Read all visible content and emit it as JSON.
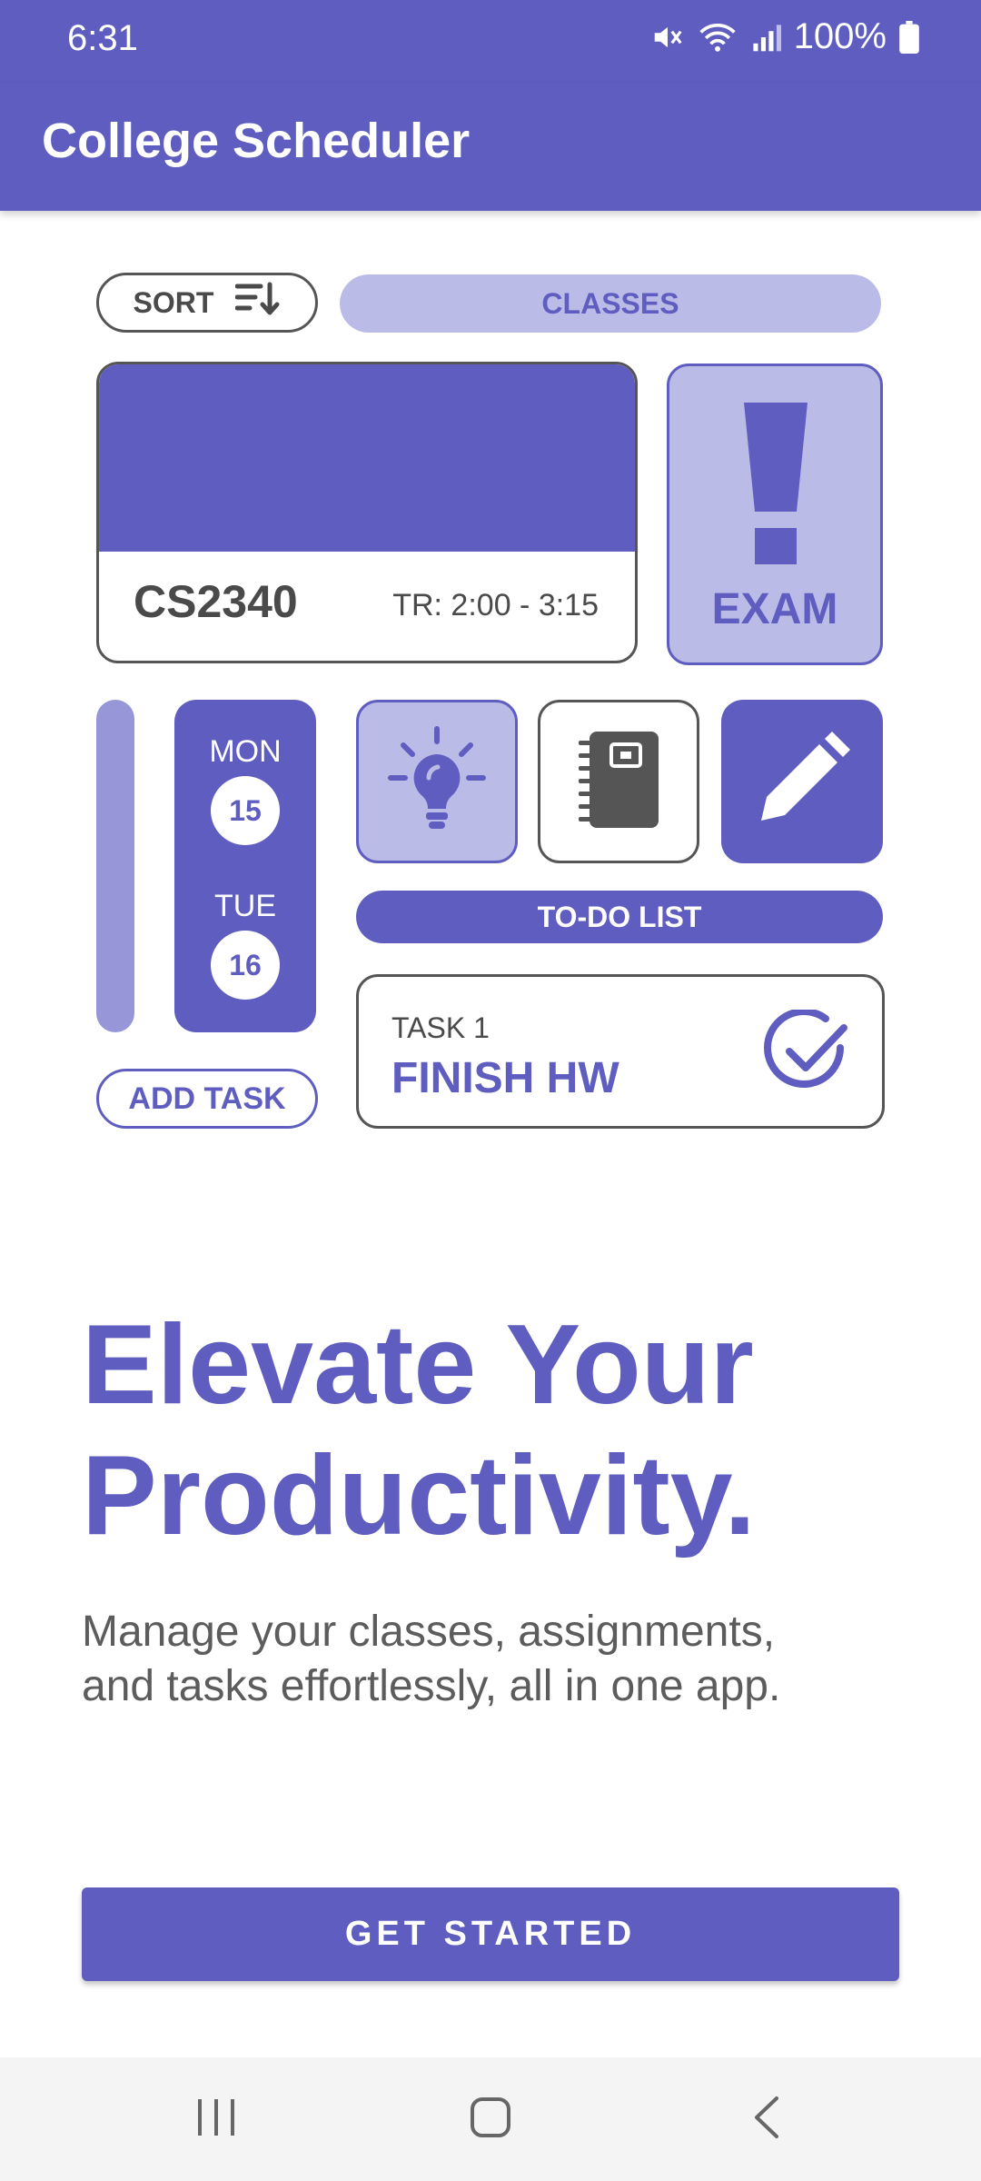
{
  "status_bar": {
    "time": "6:31",
    "battery": "100%"
  },
  "app_bar": {
    "title": "College Scheduler"
  },
  "illustration": {
    "sort_label": "SORT",
    "classes_label": "CLASSES",
    "class_card": {
      "code": "CS2340",
      "time": "TR: 2:00 - 3:15"
    },
    "exam_label": "EXAM",
    "days": [
      {
        "name": "MON",
        "number": "15"
      },
      {
        "name": "TUE",
        "number": "16"
      }
    ],
    "todo_label": "TO-DO LIST",
    "task": {
      "label": "TASK 1",
      "title": "FINISH HW"
    },
    "add_task_label": "ADD TASK"
  },
  "hero": {
    "headline_line1": "Elevate Your",
    "headline_line2": "Productivity.",
    "subtext_line1": "Manage your classes, assignments,",
    "subtext_line2": "and tasks effortlessly, all in one app."
  },
  "cta": {
    "label": "GET STARTED"
  },
  "colors": {
    "primary": "#5f5ec0",
    "light_primary": "#bbbbe8",
    "text_dark": "#4a4a4a"
  },
  "icons": [
    "mute-icon",
    "wifi-icon",
    "signal-icon",
    "battery-icon",
    "sort-icon",
    "exclamation-icon",
    "lightbulb-icon",
    "notebook-icon",
    "pencil-icon",
    "check-circle-icon",
    "recents-icon",
    "home-icon",
    "back-icon"
  ]
}
